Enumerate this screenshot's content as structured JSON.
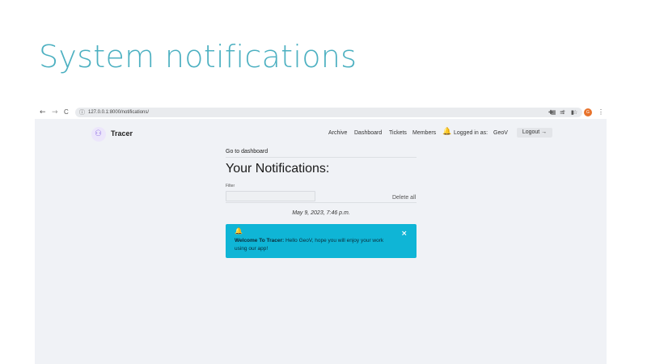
{
  "slide": {
    "title": "System notifications"
  },
  "browser": {
    "url": "127.0.0.1:8000/notifications/",
    "back_icon": "←",
    "forward_icon": "→",
    "reload_icon": "C",
    "info_icon": "ⓘ",
    "toolbar_icons": [
      "▦",
      "⇪",
      "☆",
      "✚",
      "≡",
      "▮"
    ],
    "profile_initial": "G",
    "menu_icon": "⋮"
  },
  "app": {
    "brand": "Tracer",
    "logo_glyph": "⚇",
    "nav": [
      "Archive",
      "Dashboard",
      "Tickets",
      "Members"
    ],
    "bell_icon": "🔔",
    "logged_in_label": "Logged in as:",
    "username": "GeoV",
    "logout_label": "Logout →"
  },
  "notifications": {
    "go_dashboard": "Go to dashboard",
    "heading": "Your Notifications:",
    "filter_label": "Filter",
    "filter_value": "",
    "delete_all": "Delete all",
    "date": "May 9, 2023, 7:46 p.m.",
    "item": {
      "icon": "🔔",
      "title": "Welcome To Tracer:",
      "message": " Hello GeoV, hope you will enjoy your work using our app!",
      "close": "×"
    }
  },
  "colors": {
    "slide_title": "#4cb0c1",
    "alert_bg": "#0fb5d6",
    "page_bg": "#f0f2f6",
    "bell": "#2e9a4a",
    "profile": "#e8732c"
  }
}
